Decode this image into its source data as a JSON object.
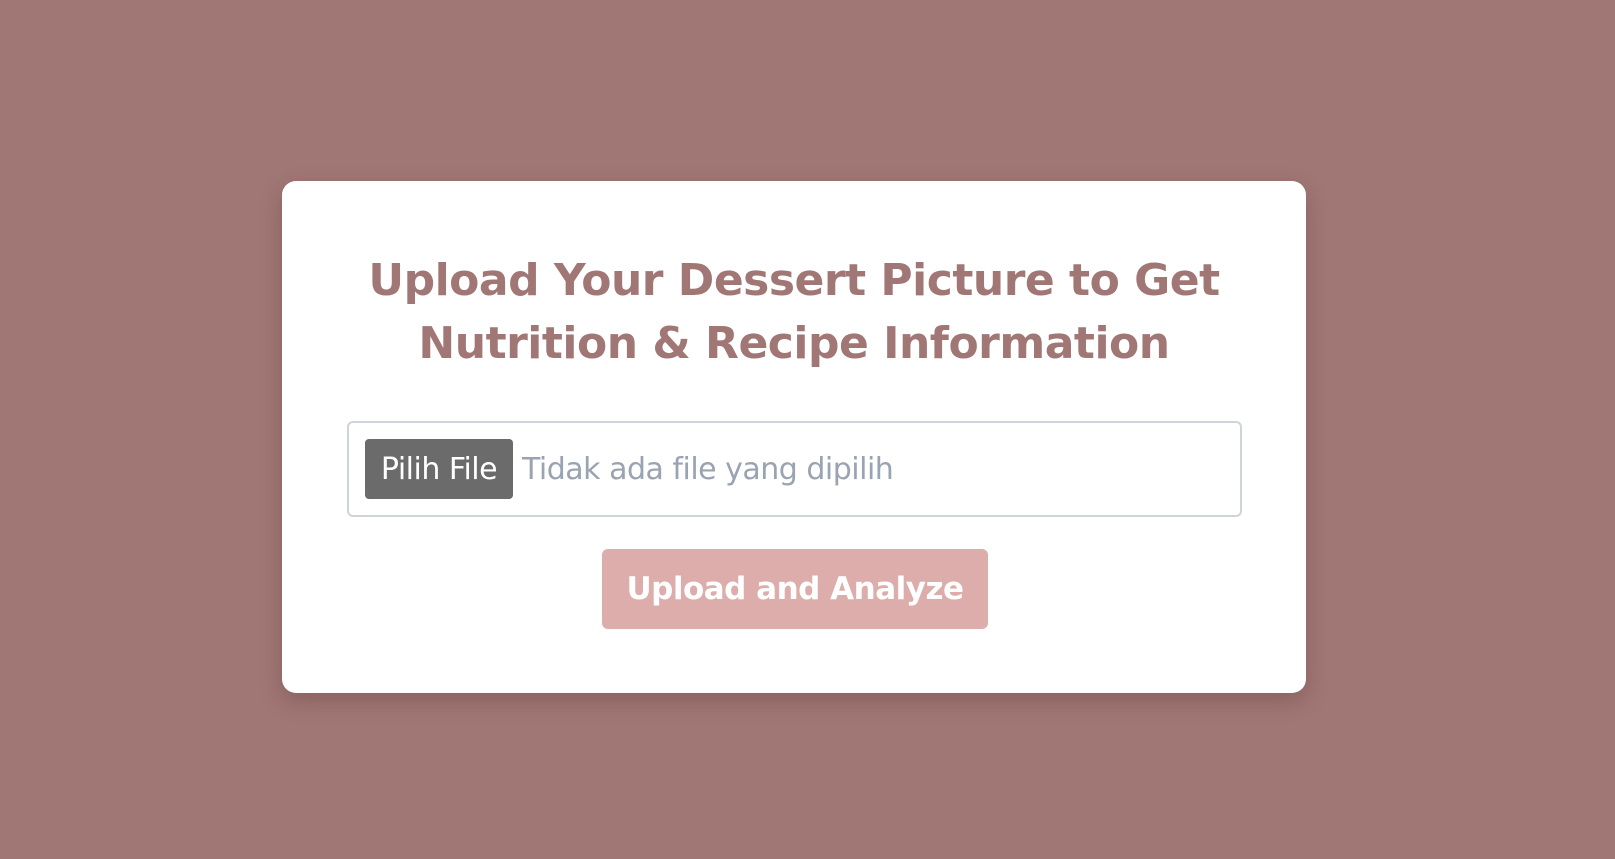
{
  "card": {
    "title_line_1": "Upload Your Dessert Picture to Get",
    "title_line_2": "Nutrition & Recipe Information"
  },
  "file_input": {
    "button_label": "Pilih File",
    "status_text": "Tidak ada file yang dipilih"
  },
  "submit": {
    "label": "Upload and Analyze"
  },
  "colors": {
    "background": "#a07775",
    "title": "#a07775",
    "file_button": "#6b6b6b",
    "submit_button": "#dcadab"
  }
}
